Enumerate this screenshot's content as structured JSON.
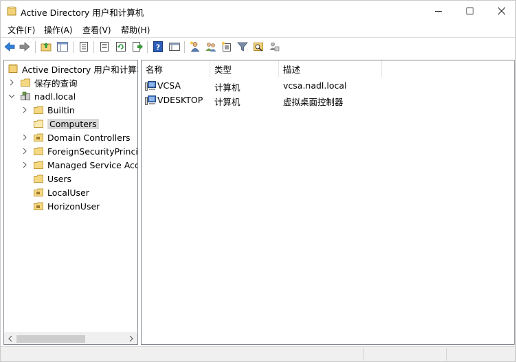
{
  "window": {
    "title": "Active Directory 用户和计算机",
    "controls": {
      "minimize": "—",
      "maximize": "☐",
      "close": "✕"
    }
  },
  "menu": {
    "items": [
      {
        "label": "文件(F)"
      },
      {
        "label": "操作(A)"
      },
      {
        "label": "查看(V)"
      },
      {
        "label": "帮助(H)"
      }
    ]
  },
  "toolbar": {
    "buttons": [
      "back-icon",
      "forward-icon",
      "up-folder-icon",
      "show-hide-tree-icon",
      "properties-icon",
      "export-list-icon",
      "refresh-icon",
      "export-icon",
      "help-icon",
      "console-icon",
      "new-user-icon",
      "new-group-icon",
      "new-ou-icon",
      "filter-icon",
      "find-icon",
      "delegate-icon"
    ]
  },
  "tree": {
    "root": "Active Directory 用户和计算机",
    "saved_queries": "保存的查询",
    "domain": "nadl.local",
    "children": [
      {
        "label": "Builtin",
        "expandable": true
      },
      {
        "label": "Computers",
        "expandable": false,
        "selected": true
      },
      {
        "label": "Domain Controllers",
        "expandable": true
      },
      {
        "label": "ForeignSecurityPrincipals",
        "expandable": true
      },
      {
        "label": "Managed Service Accounts",
        "expandable": true
      },
      {
        "label": "Users",
        "expandable": false
      },
      {
        "label": "LocalUser",
        "expandable": false
      },
      {
        "label": "HorizonUser",
        "expandable": false
      }
    ]
  },
  "list": {
    "columns": [
      "名称",
      "类型",
      "描述"
    ],
    "rows": [
      {
        "name": "VCSA",
        "type": "计算机",
        "description": "vcsa.nadl.local"
      },
      {
        "name": "VDESKTOP",
        "type": "计算机",
        "description": "虚拟桌面控制器"
      }
    ]
  },
  "colors": {
    "folder": "#e8c25a",
    "selection": "#d9d9d9",
    "border": "#828790"
  }
}
